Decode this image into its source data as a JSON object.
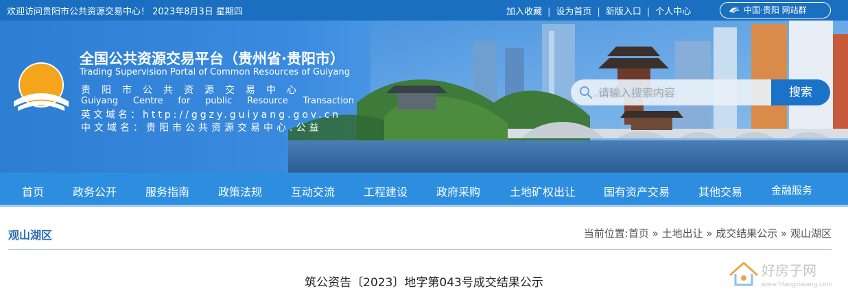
{
  "topbar": {
    "welcome": "欢迎访问贵阳市公共资源交易中心！  2023年8月3日  星期四",
    "links": [
      "加入收藏",
      "设为首页",
      "新版入口",
      "个人中心"
    ],
    "site_group": "中国·贵阳  网站群"
  },
  "header": {
    "title_cn": "全国公共资源交易平台（贵州省·贵阳市）",
    "title_en": "Trading Supervision Portal of Common Resources of Guiyang",
    "org_cn": "贵阳市公共资源交易中心",
    "org_en_words": [
      "Guiyang",
      "Centre",
      "for",
      "public",
      "Resource",
      "Transaction"
    ],
    "domain_en": "英文域名：http://ggzy.guiyang.gov.cn",
    "domain_cn": "中文域名：贵阳市公共资源交易中心.公益"
  },
  "search": {
    "placeholder": "请输入搜索内容",
    "button": "搜索"
  },
  "nav": {
    "items": [
      "首页",
      "政务公开",
      "服务指南",
      "政策法规",
      "互动交流",
      "工程建设",
      "政府采购",
      "土地矿权出让",
      "国有资产交易",
      "其他交易",
      "金融服务"
    ]
  },
  "content": {
    "section_title": "观山湖区",
    "breadcrumb": "当前位置:首页 » 土地出让 » 成交结果公示 » 观山湖区",
    "article_title": "筑公资告〔2023〕地字第043号成交结果公示"
  },
  "watermark": {
    "text_cn": "好房子网",
    "text_en": "www.hfangziwang.com"
  },
  "colors": {
    "topbar": "#1b6fc0",
    "nav": "#2d8ee0",
    "accent": "#2a6db3",
    "search_button": "#1b73c9"
  }
}
